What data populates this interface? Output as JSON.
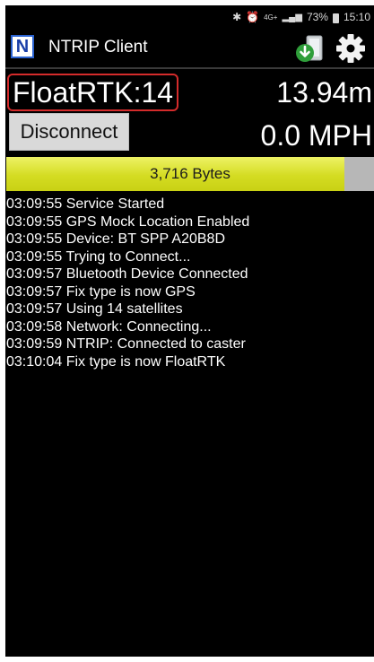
{
  "status_bar": {
    "signal": "4G+",
    "battery": "73%",
    "time": "15:10"
  },
  "action_bar": {
    "logo_letter": "N",
    "title": "NTRIP Client",
    "icons": [
      "download-icon",
      "settings-icon"
    ]
  },
  "fix": {
    "status": "FloatRTK:14",
    "altitude": "13.94m"
  },
  "controls": {
    "disconnect_label": "Disconnect",
    "speed": "0.0 MPH"
  },
  "bytes": {
    "label": "3,716 Bytes",
    "progress": 0.92
  },
  "log": [
    "03:09:55 Service Started",
    "03:09:55 GPS Mock Location Enabled",
    "03:09:55 Device: BT SPP A20B8D",
    "03:09:55 Trying to Connect...",
    "03:09:57 Bluetooth Device Connected",
    "03:09:57 Fix type is now GPS",
    "03:09:57 Using 14 satellites",
    "03:09:58 Network: Connecting...",
    "03:09:59 NTRIP: Connected to caster",
    "03:10:04 Fix type is now FloatRTK"
  ],
  "colors": {
    "background": "#000000",
    "fix_border": "#d42b2b",
    "progress_fill": "#d4dc22",
    "progress_track": "#b7b7b7",
    "logo_border": "#2b63d1"
  }
}
